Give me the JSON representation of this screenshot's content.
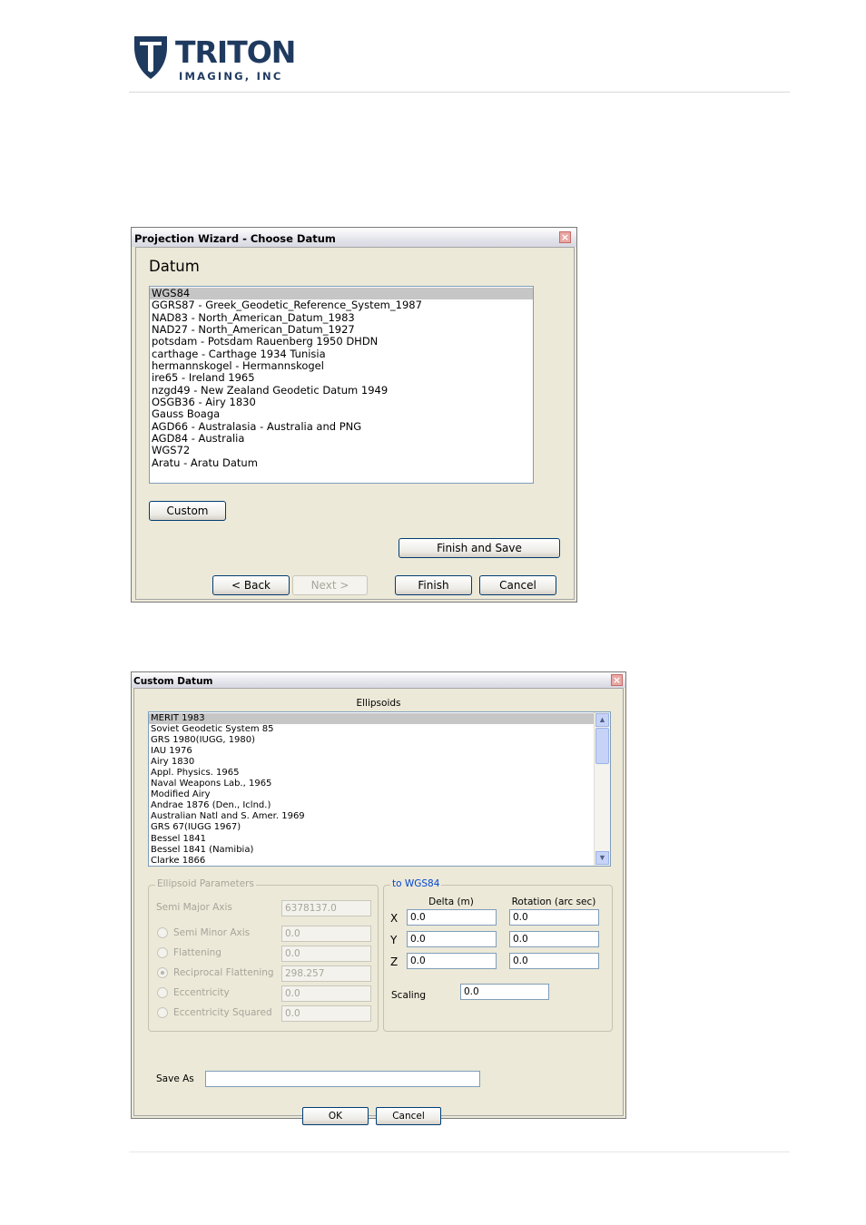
{
  "header": {
    "brand_name": "TRITON",
    "brand_sub": "IMAGING, INC"
  },
  "wizard": {
    "title": "Projection Wizard - Choose Datum",
    "heading": "Datum",
    "datums": [
      "WGS84",
      "GGRS87 - Greek_Geodetic_Reference_System_1987",
      "NAD83 - North_American_Datum_1983",
      "NAD27 - North_American_Datum_1927",
      "potsdam - Potsdam Rauenberg 1950 DHDN",
      "carthage - Carthage 1934 Tunisia",
      "hermannskogel - Hermannskogel",
      "ire65 - Ireland 1965",
      "nzgd49 - New Zealand Geodetic Datum 1949",
      "OSGB36 - Airy 1830",
      "Gauss Boaga",
      "AGD66 - Australasia - Australia and PNG",
      "AGD84 - Australia",
      "WGS72",
      "Aratu - Aratu Datum"
    ],
    "selected_index": 0,
    "custom_label": "Custom",
    "finish_save_label": "Finish and Save",
    "back_label": "< Back",
    "next_label": "Next >",
    "finish_label": "Finish",
    "cancel_label": "Cancel"
  },
  "custom": {
    "title": "Custom Datum",
    "ellipsoids_label": "Ellipsoids",
    "ellipsoids": [
      "MERIT 1983",
      "Soviet Geodetic System 85",
      "GRS 1980(IUGG, 1980)",
      "IAU 1976",
      "Airy 1830",
      "Appl. Physics. 1965",
      "Naval Weapons Lab., 1965",
      "Modified Airy",
      "Andrae 1876 (Den., Iclnd.)",
      "Australian Natl and S. Amer. 1969",
      "GRS 67(IUGG 1967)",
      "Bessel 1841",
      "Bessel 1841 (Namibia)",
      "Clarke 1866"
    ],
    "selected_index": 0,
    "params_group": "Ellipsoid Parameters",
    "semi_major_label": "Semi Major Axis",
    "semi_major_value": "6378137.0",
    "params": [
      {
        "label": "Semi Minor Axis",
        "value": "0.0",
        "checked": false
      },
      {
        "label": "Flattening",
        "value": "0.0",
        "checked": false
      },
      {
        "label": "Reciprocal Flattening",
        "value": "298.257",
        "checked": true
      },
      {
        "label": "Eccentricity",
        "value": "0.0",
        "checked": false
      },
      {
        "label": "Eccentricity Squared",
        "value": "0.0",
        "checked": false
      }
    ],
    "wgs_group": "to WGS84",
    "delta_header": "Delta (m)",
    "rotation_header": "Rotation (arc sec)",
    "rows": [
      {
        "axis": "X",
        "delta": "0.0",
        "rotation": "0.0"
      },
      {
        "axis": "Y",
        "delta": "0.0",
        "rotation": "0.0"
      },
      {
        "axis": "Z",
        "delta": "0.0",
        "rotation": "0.0"
      }
    ],
    "scaling_label": "Scaling",
    "scaling_value": "0.0",
    "save_as_label": "Save As",
    "save_as_value": "",
    "ok_label": "OK",
    "cancel_label": "Cancel"
  }
}
